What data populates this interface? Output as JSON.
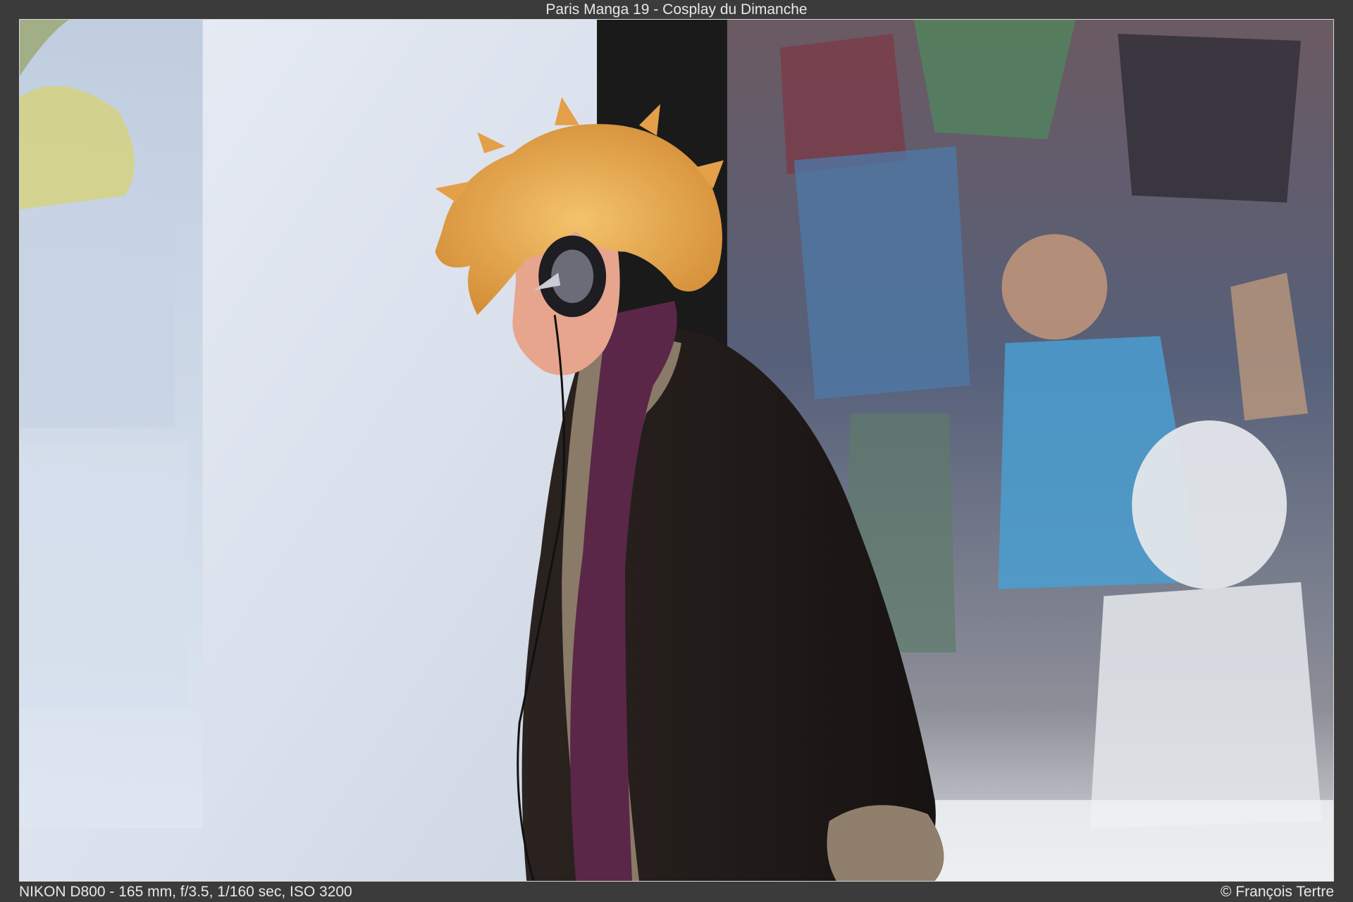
{
  "title": "Paris Manga 19 - Cosplay du Dimanche",
  "exif": "NIKON D800 - 165 mm, f/3.5, 1/160 sec, ISO 3200",
  "credit": "© François Tertre",
  "photo": {
    "description_icon": "cosplay-photo",
    "colors": {
      "screen": "#dfe4ef",
      "backdrop": "#1c1c1c",
      "poster": "#5b6170",
      "wig": "#e6a64b",
      "coat": "#231d1b",
      "fur": "#8a7a68",
      "shirt": "#5a2748",
      "skin": "#e7a58d",
      "frame_border": "#d8d8d8",
      "caption_text": "#e8e8e8",
      "page_bg": "#3b3b3b"
    }
  }
}
